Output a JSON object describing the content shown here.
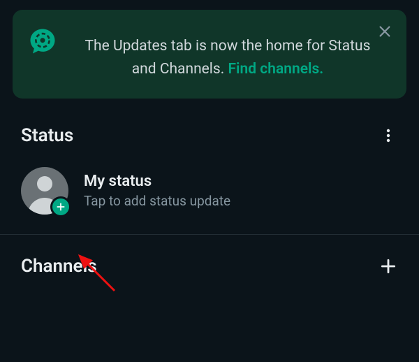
{
  "banner": {
    "text_line1": "The Updates tab is now the home for",
    "text_line2": "Status and Channels. ",
    "link_text": "Find channels.",
    "icon": "status-bubble-icon",
    "close_icon": "close-icon"
  },
  "status_section": {
    "title": "Status",
    "more_icon": "more-vertical-icon",
    "my_status": {
      "title": "My status",
      "subtitle": "Tap to add status update",
      "badge_icon": "plus-icon"
    }
  },
  "channels_section": {
    "title": "Channels",
    "add_icon": "plus-icon"
  },
  "colors": {
    "accent": "#00a884",
    "banner_bg": "#103629",
    "page_bg": "#0b141a",
    "text_primary": "#e9edef",
    "text_secondary": "#8696a0"
  }
}
